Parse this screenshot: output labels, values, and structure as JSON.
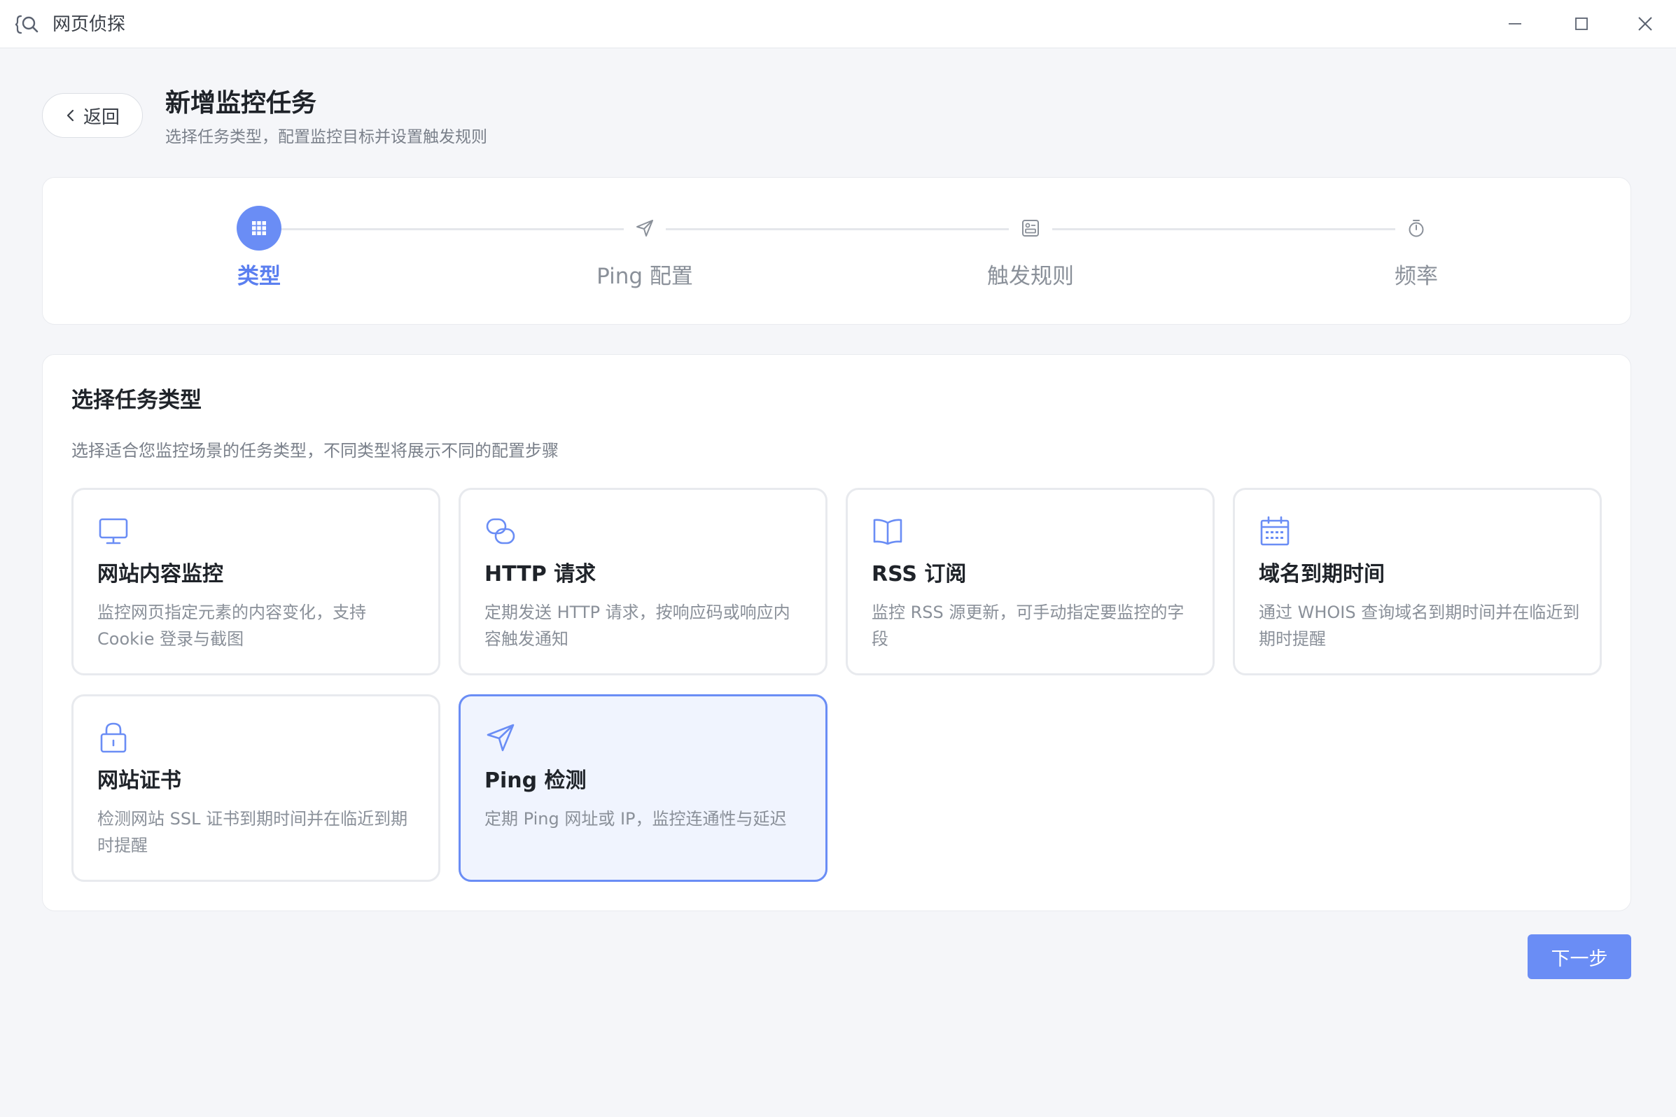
{
  "app": {
    "title": "网页侦探"
  },
  "header": {
    "back_label": "返回",
    "title": "新增监控任务",
    "subtitle": "选择任务类型，配置监控目标并设置触发规则"
  },
  "steps": [
    {
      "label": "类型",
      "icon": "grid-icon",
      "active": true
    },
    {
      "label": "Ping 配置",
      "icon": "send-icon",
      "active": false
    },
    {
      "label": "触发规则",
      "icon": "rule-icon",
      "active": false
    },
    {
      "label": "频率",
      "icon": "timer-icon",
      "active": false
    }
  ],
  "section": {
    "title": "选择任务类型",
    "desc": "选择适合您监控场景的任务类型，不同类型将展示不同的配置步骤"
  },
  "options": [
    {
      "title": "网站内容监控",
      "desc": "监控网页指定元素的内容变化，支持 Cookie 登录与截图",
      "icon": "monitor-icon",
      "selected": false
    },
    {
      "title": "HTTP 请求",
      "desc": "定期发送 HTTP 请求，按响应码或响应内容触发通知",
      "icon": "link-icon",
      "selected": false
    },
    {
      "title": "RSS 订阅",
      "desc": "监控 RSS 源更新，可手动指定要监控的字段",
      "icon": "book-icon",
      "selected": false
    },
    {
      "title": "域名到期时间",
      "desc": "通过 WHOIS 查询域名到期时间并在临近到期时提醒",
      "icon": "calendar-icon",
      "selected": false
    },
    {
      "title": "网站证书",
      "desc": "检测网站 SSL 证书到期时间并在临近到期时提醒",
      "icon": "lock-icon",
      "selected": false
    },
    {
      "title": "Ping 检测",
      "desc": "定期 Ping 网址或 IP，监控连通性与延迟",
      "icon": "send-icon",
      "selected": true
    }
  ],
  "footer": {
    "next_label": "下一步"
  },
  "colors": {
    "accent": "#6a8df5",
    "selected_bg": "#f0f4fe"
  }
}
